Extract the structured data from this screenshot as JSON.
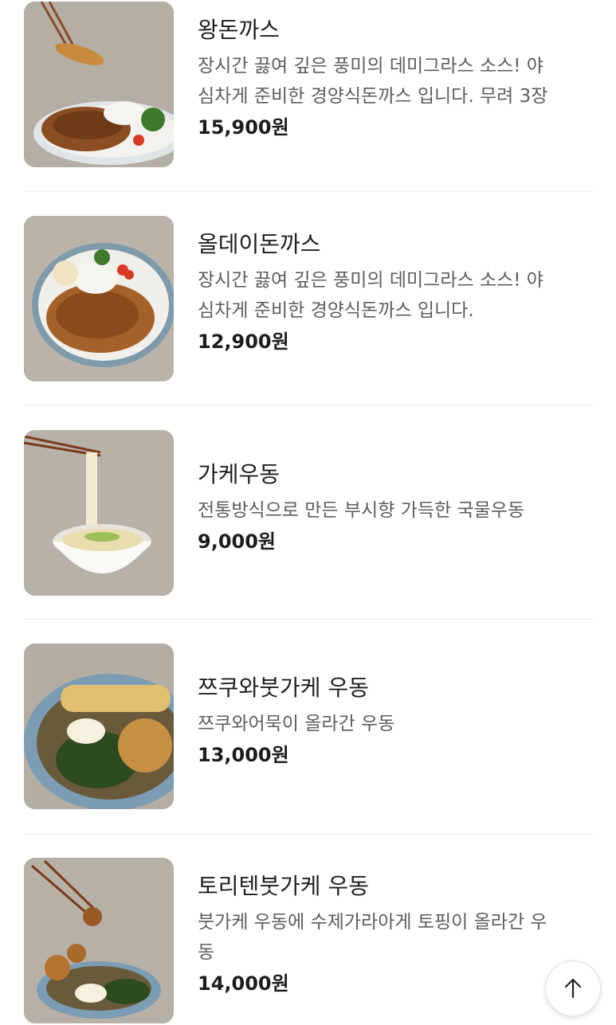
{
  "menu": {
    "items": [
      {
        "name": "왕돈까스",
        "desc_lines": [
          "장시간 끓여 깊은 풍미의 데미그라스 소스! 야",
          "심차게 준비한 경양식돈까스 입니다. 무려 3장"
        ],
        "price": "15,900원",
        "image": "tonkatsu-chopsticks-photo"
      },
      {
        "name": "올데이돈까스",
        "desc_lines": [
          "장시간 끓여 깊은 풍미의 데미그라스 소스! 야",
          "심차게 준비한 경양식돈까스 입니다."
        ],
        "price": "12,900원",
        "image": "tonkatsu-plate-photo"
      },
      {
        "name": "가케우동",
        "desc_lines": [
          "전통방식으로 만든 부시향 가득한 국물우동"
        ],
        "price": "9,000원",
        "image": "udon-noodle-lift-photo"
      },
      {
        "name": "쯔쿠와붓가케 우동",
        "desc_lines": [
          "쯔쿠와어묵이 올라간 우동"
        ],
        "price": "13,000원",
        "image": "bukkake-udon-tempura-photo"
      },
      {
        "name": "토리텐붓가케 우동",
        "desc_lines": [
          "붓가케 우동에 수제가라아게 토핑이 올라간 우",
          "동"
        ],
        "price": "14,000원",
        "image": "chicken-bukkake-udon-photo"
      }
    ]
  },
  "icons": {
    "scroll_top": "arrow-up-icon"
  },
  "colors": {
    "name_text": "#1e1e1e",
    "desc_text": "#5d5d5d",
    "price_text": "#1c1c1c",
    "divider": "#ececec"
  }
}
